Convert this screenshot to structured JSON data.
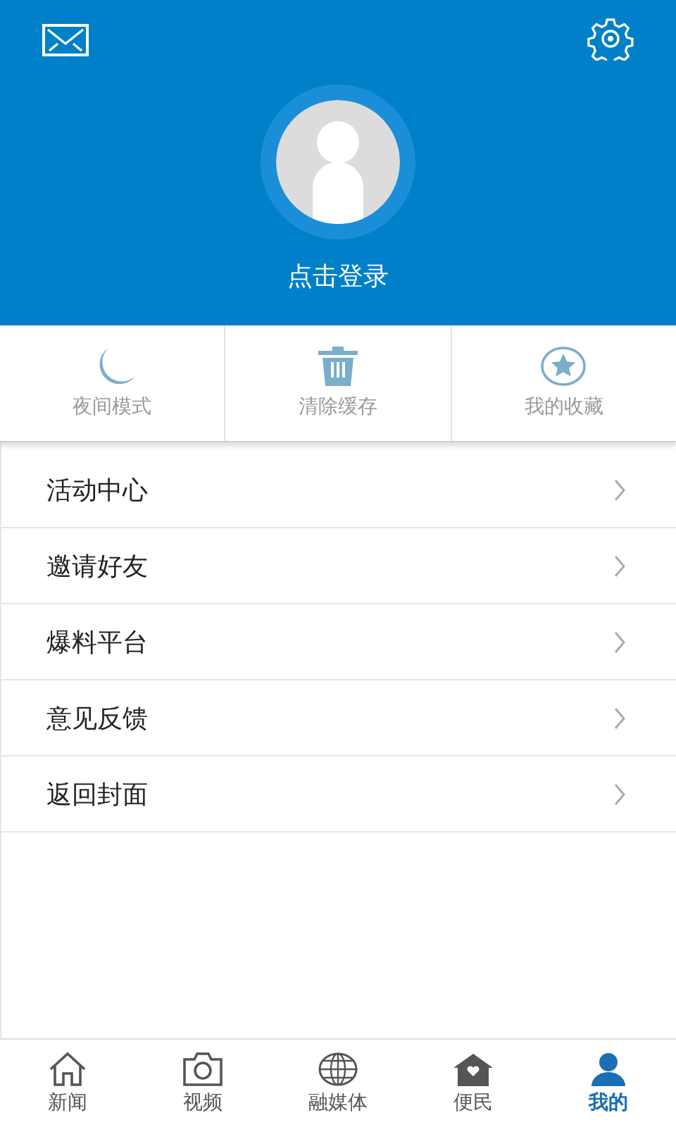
{
  "header": {
    "login_label": "点击登录"
  },
  "quick_actions": [
    {
      "label": "夜间模式"
    },
    {
      "label": "清除缓存"
    },
    {
      "label": "我的收藏"
    }
  ],
  "menu": [
    {
      "label": "活动中心"
    },
    {
      "label": "邀请好友"
    },
    {
      "label": "爆料平台"
    },
    {
      "label": "意见反馈"
    },
    {
      "label": "返回封面"
    }
  ],
  "tab_bar": [
    {
      "label": "新闻",
      "selected": false
    },
    {
      "label": "视频",
      "selected": false
    },
    {
      "label": "融媒体",
      "selected": false
    },
    {
      "label": "便民",
      "selected": false
    },
    {
      "label": "我的",
      "selected": true
    }
  ]
}
